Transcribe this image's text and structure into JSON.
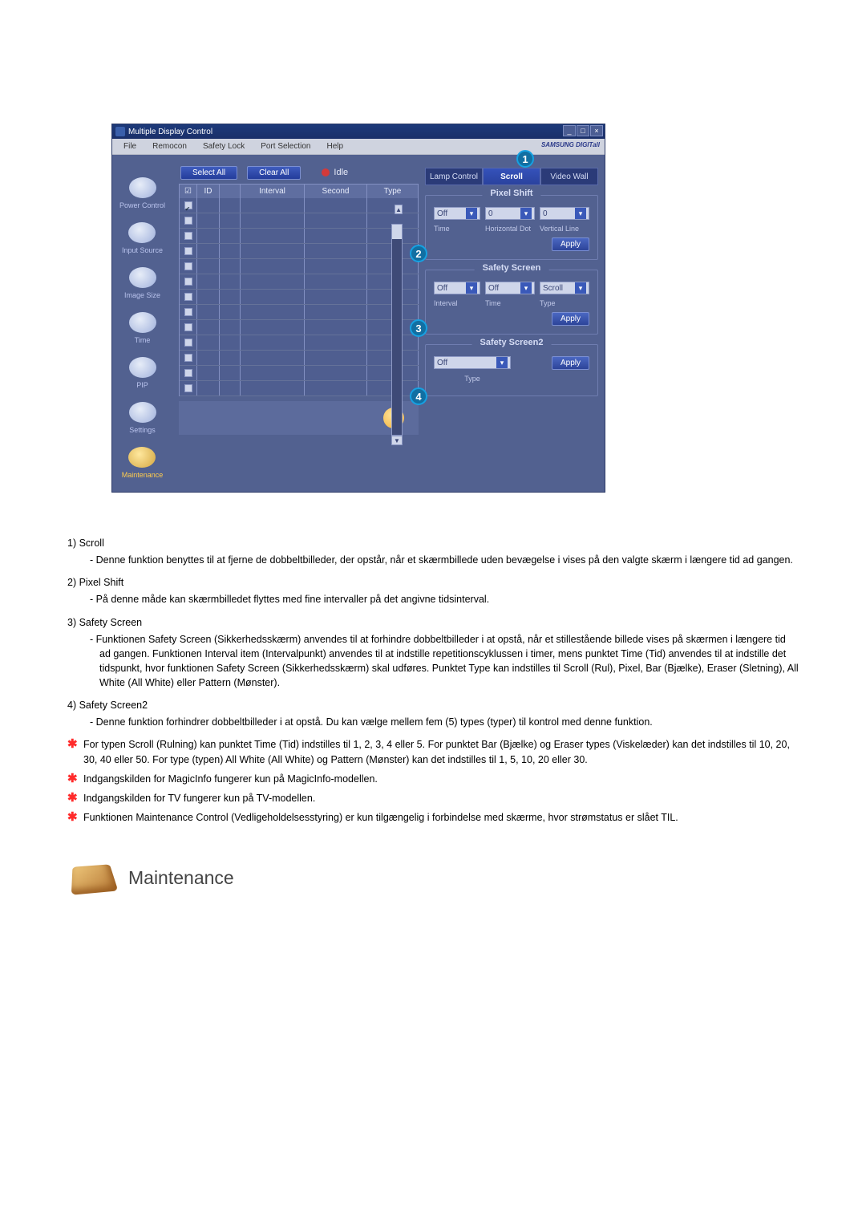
{
  "app": {
    "title": "Multiple Display Control",
    "menubar": [
      "File",
      "Remocon",
      "Safety Lock",
      "Port Selection",
      "Help"
    ],
    "brand": "SAMSUNG DIGITall"
  },
  "top_buttons": {
    "select_all": "Select All",
    "clear_all": "Clear All",
    "idle": "Idle"
  },
  "sidebar": {
    "items": [
      {
        "label": "Power Control"
      },
      {
        "label": "Input Source"
      },
      {
        "label": "Image Size"
      },
      {
        "label": "Time"
      },
      {
        "label": "PIP"
      },
      {
        "label": "Settings"
      },
      {
        "label": "Maintenance"
      }
    ]
  },
  "grid": {
    "headers": {
      "check": "☑",
      "id": "ID",
      "lamp": "",
      "interval": "Interval",
      "second": "Second",
      "type": "Type"
    },
    "row_count": 13
  },
  "tabs": {
    "lamp": "Lamp Control",
    "scroll": "Scroll",
    "video": "Video Wall",
    "active": 1
  },
  "pixel_shift": {
    "title": "Pixel Shift",
    "time_value": "Off",
    "horiz_value": "0",
    "vert_value": "0",
    "sub": {
      "time": "Time",
      "horiz": "Horizontal Dot",
      "vert": "Vertical Line"
    },
    "apply": "Apply"
  },
  "safety_screen": {
    "title": "Safety Screen",
    "interval_value": "Off",
    "time_value": "Off",
    "type_value": "Scroll",
    "sub": {
      "interval": "Interval",
      "time": "Time",
      "type": "Type"
    },
    "apply": "Apply"
  },
  "safety_screen2": {
    "title": "Safety Screen2",
    "type_value": "Off",
    "sub": {
      "type": "Type"
    },
    "apply": "Apply"
  },
  "callouts": {
    "c1": "1",
    "c2": "2",
    "c3": "3",
    "c4": "4"
  },
  "explain": {
    "i1_head": "1)  Scroll",
    "i1_body": "- Denne funktion benyttes til at fjerne de dobbeltbilleder, der opstår, når et skærmbillede uden bevægelse i vises på den valgte skærm i længere tid ad gangen.",
    "i2_head": "2)  Pixel Shift",
    "i2_body": "- På denne måde kan skærmbilledet flyttes med fine intervaller på det angivne tidsinterval.",
    "i3_head": "3)  Safety Screen",
    "i3_body": "- Funktionen Safety Screen (Sikkerhedsskærm) anvendes til at forhindre dobbeltbilleder i at opstå, når et stillestående billede vises på skærmen i længere tid ad gangen.  Funktionen Interval item (Intervalpunkt) anvendes til at indstille repetitionscyklussen i timer, mens punktet Time (Tid) anvendes til at indstille det tidspunkt, hvor funktionen Safety Screen (Sikkerhedsskærm) skal udføres. Punktet Type kan indstilles til Scroll (Rul), Pixel, Bar (Bjælke), Eraser (Sletning), All White (All White) eller Pattern (Mønster).",
    "i4_head": "4)  Safety Screen2",
    "i4_body": "- Denne funktion forhindrer dobbeltbilleder i at opstå. Du kan vælge mellem fem (5) types (typer) til kontrol med denne funktion.",
    "s1": "For typen Scroll (Rulning) kan punktet Time (Tid) indstilles til 1, 2, 3, 4 eller 5. For punktet Bar (Bjælke) og Eraser types (Viskelæder) kan det indstilles til 10, 20, 30, 40 eller 50. For type (typen) All White (All White) og Pattern (Mønster) kan det indstilles til 1, 5, 10, 20 eller 30.",
    "s2": "Indgangskilden for MagicInfo fungerer kun på MagicInfo-modellen.",
    "s3": "Indgangskilden for TV fungerer kun på TV-modellen.",
    "s4": "Funktionen Maintenance Control (Vedligeholdelsesstyring) er kun tilgængelig i forbindelse med skærme, hvor strømstatus er slået TIL."
  },
  "section_head": "Maintenance"
}
